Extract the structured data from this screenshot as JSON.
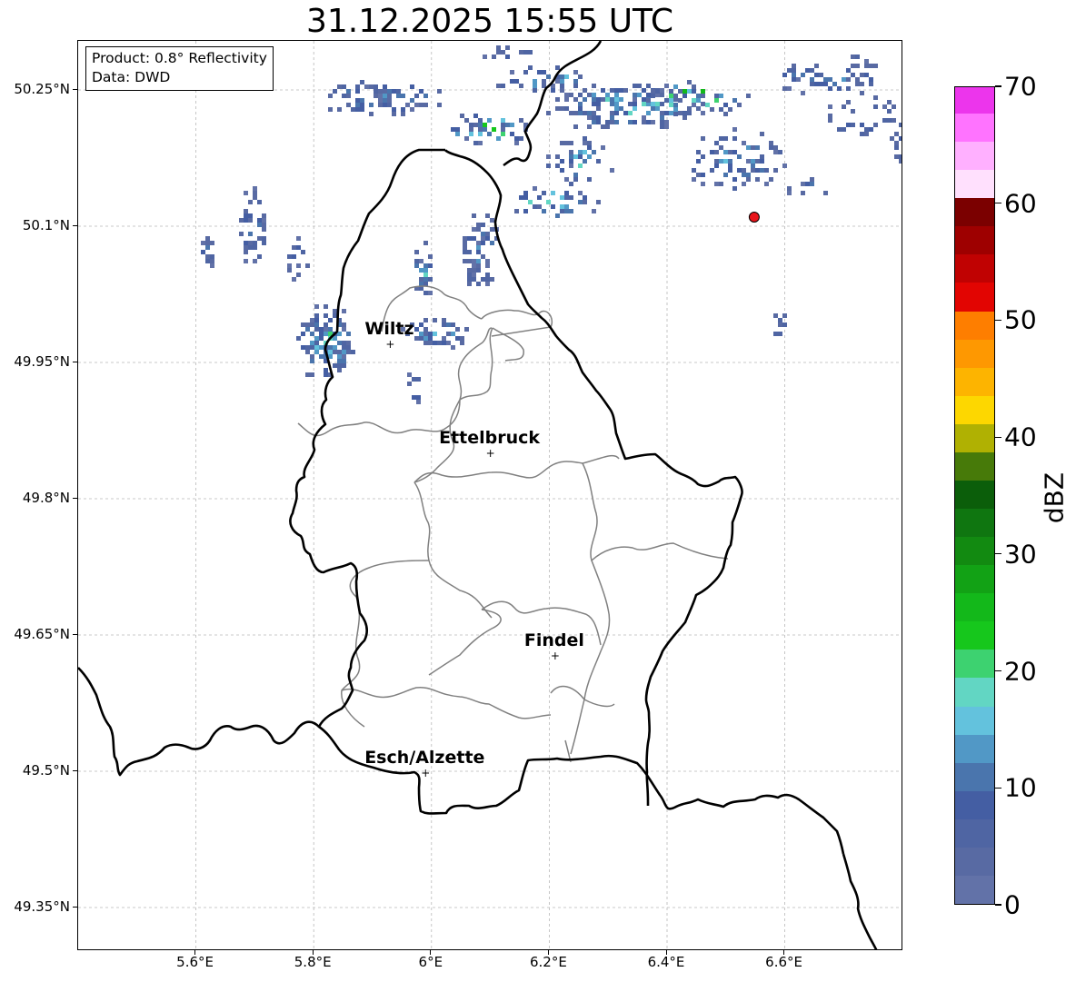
{
  "title": "31.12.2025 15:55 UTC",
  "info_box": {
    "product_line": "Product: 0.8° Reflectivity",
    "data_line": "Data: DWD"
  },
  "map_extent": {
    "lon_min": 5.4,
    "lon_max": 6.8,
    "lat_min": 49.3,
    "lat_max": 50.3
  },
  "latitude_ticks": [
    {
      "value": 50.25,
      "label": "50.25°N"
    },
    {
      "value": 50.1,
      "label": "50.1°N"
    },
    {
      "value": 49.95,
      "label": "49.95°N"
    },
    {
      "value": 49.8,
      "label": "49.8°N"
    },
    {
      "value": 49.65,
      "label": "49.65°N"
    },
    {
      "value": 49.5,
      "label": "49.5°N"
    },
    {
      "value": 49.35,
      "label": "49.35°N"
    }
  ],
  "longitude_ticks": [
    {
      "value": 5.6,
      "label": "5.6°E"
    },
    {
      "value": 5.8,
      "label": "5.8°E"
    },
    {
      "value": 6.0,
      "label": "6°E"
    },
    {
      "value": 6.2,
      "label": "6.2°E"
    },
    {
      "value": 6.4,
      "label": "6.4°E"
    },
    {
      "value": 6.6,
      "label": "6.6°E"
    }
  ],
  "cities": [
    {
      "name": "Wiltz",
      "lon": 5.93,
      "lat": 49.97
    },
    {
      "name": "Ettelbruck",
      "lon": 6.1,
      "lat": 49.85
    },
    {
      "name": "Findel",
      "lon": 6.21,
      "lat": 49.627
    },
    {
      "name": "Esch/Alzette",
      "lon": 5.99,
      "lat": 49.498
    }
  ],
  "radar_site": {
    "lon": 6.548,
    "lat": 50.11,
    "color": "#e8141a"
  },
  "colorbar": {
    "label": "dBZ",
    "min": 0,
    "max": 70,
    "step": 2.5,
    "tick_values": [
      0,
      10,
      20,
      30,
      40,
      50,
      60,
      70
    ],
    "tick_labels": [
      "0",
      "10",
      "20",
      "30",
      "40",
      "50",
      "60",
      "70"
    ],
    "colors": [
      "#6272a8",
      "#586aa3",
      "#4f65a3",
      "#445ea3",
      "#4a75ad",
      "#5198c6",
      "#63c2dd",
      "#62d6c3",
      "#3dd270",
      "#16c71c",
      "#13b81a",
      "#12a215",
      "#128a11",
      "#0f7610",
      "#0b5e0a",
      "#477a09",
      "#b0b102",
      "#fdd700",
      "#fdb400",
      "#fe9801",
      "#fe7e00",
      "#e20502",
      "#c00202",
      "#9e0000",
      "#7b0000",
      "#ffe0fd",
      "#ffb0ff",
      "#ff73ff",
      "#ec35ec"
    ]
  },
  "map_colors": {
    "national_border": "#000000",
    "canton_border": "#808080",
    "gridline": "#b8b8b8",
    "radar_base": "#5470a8"
  }
}
